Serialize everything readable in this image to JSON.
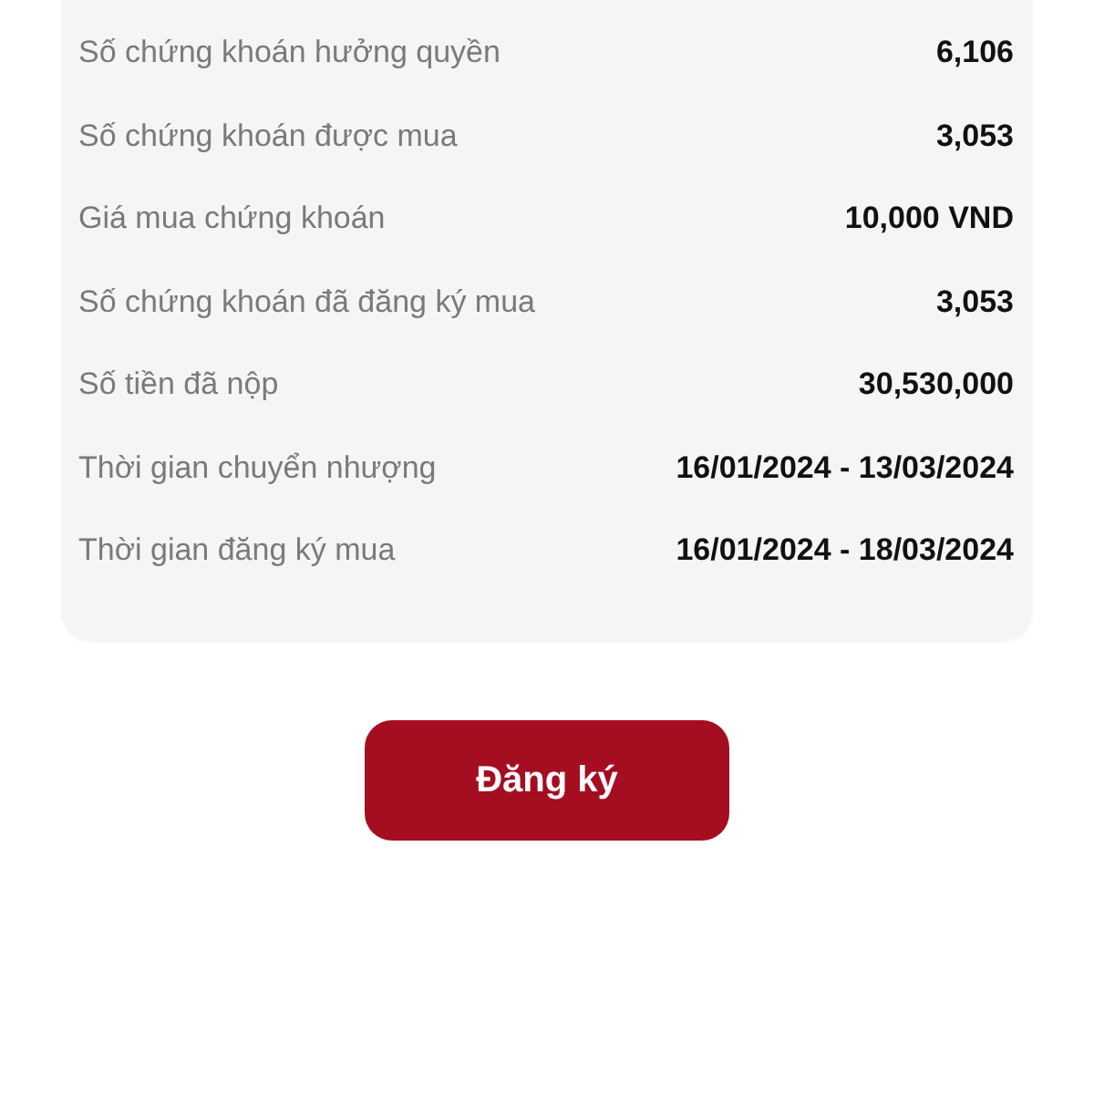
{
  "details": [
    {
      "label": "Số chứng khoán hưởng quyền",
      "value": "6,106"
    },
    {
      "label": "Số chứng khoán được mua",
      "value": "3,053"
    },
    {
      "label": "Giá mua chứng khoán",
      "value": "10,000 VND"
    },
    {
      "label": "Số chứng khoán đã đăng ký mua",
      "value": "3,053"
    },
    {
      "label": "Số tiền đã nộp",
      "value": "30,530,000"
    },
    {
      "label": "Thời gian chuyển nhượng",
      "value": "16/01/2024 - 13/03/2024"
    },
    {
      "label": "Thời gian đăng ký mua",
      "value": "16/01/2024 - 18/03/2024"
    }
  ],
  "button": "Đăng ký"
}
